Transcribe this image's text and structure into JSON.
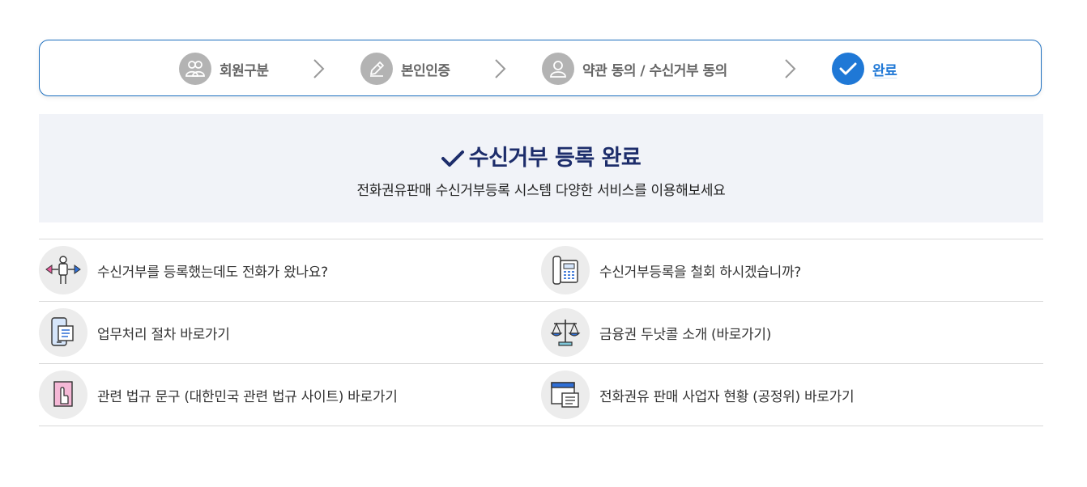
{
  "steps": [
    {
      "label": "회원구분",
      "icon": "users-icon",
      "active": false
    },
    {
      "label": "본인인증",
      "icon": "pencil-icon",
      "active": false
    },
    {
      "label": "약관 동의 / 수신거부 동의",
      "icon": "user-icon",
      "active": false
    },
    {
      "label": "완료",
      "icon": "check-icon",
      "active": true
    }
  ],
  "banner": {
    "title": "수신거부 등록 완료",
    "subtitle": "전화권유판매 수신거부등록 시스템 다양한 서비스를 이용해보세요"
  },
  "links": {
    "left": [
      {
        "label": "수신거부를 등록했는데도 전화가 왔나요?",
        "icon": "person-arrows-icon"
      },
      {
        "label": "업무처리 절차 바로가기",
        "icon": "mobile-document-icon"
      },
      {
        "label": "관련 법규 문구 (대한민국 관련 법규 사이트) 바로가기",
        "icon": "hand-pointer-icon"
      }
    ],
    "right": [
      {
        "label": "수신거부등록을 철회 하시겠습니까?",
        "icon": "telephone-icon"
      },
      {
        "label": "금융권 두낫콜 소개 (바로가기)",
        "icon": "scale-icon"
      },
      {
        "label": "전화권유 판매 사업자 현황 (공정위) 바로가기",
        "icon": "window-list-icon"
      }
    ]
  },
  "colors": {
    "accent": "#1f78d6",
    "step_inactive": "#b3b3b3",
    "banner_bg": "#f1f3f8",
    "banner_title": "#1d2d6b"
  }
}
